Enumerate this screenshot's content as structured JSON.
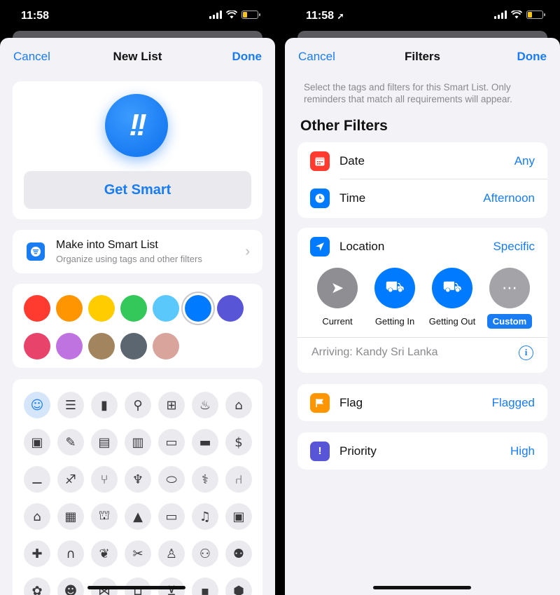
{
  "left": {
    "status_time": "11:58",
    "nav": {
      "cancel": "Cancel",
      "title": "New List",
      "done": "Done"
    },
    "list_icon_glyph": "!!",
    "list_name": "Get Smart",
    "smart_list": {
      "title": "Make into Smart List",
      "subtitle": "Organize using tags and other filters"
    },
    "colors": [
      "#ff3b30",
      "#ff9500",
      "#ffcc00",
      "#34c759",
      "#5ac8fa",
      "#007aff",
      "#5856d6",
      "#e8436b",
      "#bf73e0",
      "#a2845e",
      "#5b6670",
      "#d9a49b"
    ],
    "selected_color_index": 5,
    "icons": [
      {
        "name": "smiley-icon",
        "glyph": "☺"
      },
      {
        "name": "list-icon",
        "glyph": "☰"
      },
      {
        "name": "bookmark-icon",
        "glyph": "▮"
      },
      {
        "name": "pin-icon",
        "glyph": "⚲"
      },
      {
        "name": "gift-icon",
        "glyph": "⊞"
      },
      {
        "name": "birthday-cake-icon",
        "glyph": "♨"
      },
      {
        "name": "graduation-cap-icon",
        "glyph": "⌂"
      },
      {
        "name": "backpack-icon",
        "glyph": "▣"
      },
      {
        "name": "ruler-pencil-icon",
        "glyph": "✎"
      },
      {
        "name": "document-icon",
        "glyph": "▤"
      },
      {
        "name": "book-icon",
        "glyph": "▥"
      },
      {
        "name": "wallet-icon",
        "glyph": "▭"
      },
      {
        "name": "credit-card-icon",
        "glyph": "▬"
      },
      {
        "name": "money-icon",
        "glyph": "$"
      },
      {
        "name": "dumbbell-icon",
        "glyph": "⚊"
      },
      {
        "name": "running-icon",
        "glyph": "♐"
      },
      {
        "name": "fork-knife-icon",
        "glyph": "⑂"
      },
      {
        "name": "wine-glass-icon",
        "glyph": "♆"
      },
      {
        "name": "pills-icon",
        "glyph": "⬭"
      },
      {
        "name": "stethoscope-icon",
        "glyph": "⚕"
      },
      {
        "name": "chair-icon",
        "glyph": "⑁"
      },
      {
        "name": "house-icon",
        "glyph": "⌂"
      },
      {
        "name": "building-icon",
        "glyph": "▦"
      },
      {
        "name": "bank-icon",
        "glyph": "⛫"
      },
      {
        "name": "tent-icon",
        "glyph": "▲"
      },
      {
        "name": "desktop-icon",
        "glyph": "▭"
      },
      {
        "name": "music-note-icon",
        "glyph": "♫"
      },
      {
        "name": "computer-icon",
        "glyph": "▣"
      },
      {
        "name": "gamepad-icon",
        "glyph": "✚"
      },
      {
        "name": "headphones-icon",
        "glyph": "∩"
      },
      {
        "name": "leaf-icon",
        "glyph": "❦"
      },
      {
        "name": "carrot-icon",
        "glyph": "✂"
      },
      {
        "name": "person-icon",
        "glyph": "♙"
      },
      {
        "name": "two-people-icon",
        "glyph": "⚇"
      },
      {
        "name": "family-icon",
        "glyph": "⚉"
      },
      {
        "name": "paw-icon",
        "glyph": "✿"
      },
      {
        "name": "teddy-bear-icon",
        "glyph": "☻"
      },
      {
        "name": "fish-icon",
        "glyph": "⋈"
      },
      {
        "name": "basket-icon",
        "glyph": "⊔"
      },
      {
        "name": "cart-icon",
        "glyph": "⊻"
      },
      {
        "name": "bag-icon",
        "glyph": "▪"
      },
      {
        "name": "box-icon",
        "glyph": "⬢"
      }
    ]
  },
  "right": {
    "status_time": "11:58",
    "nav": {
      "cancel": "Cancel",
      "title": "Filters",
      "done": "Done"
    },
    "description": "Select the tags and filters for this Smart List. Only reminders that match all requirements will appear.",
    "section_title": "Other Filters",
    "date": {
      "label": "Date",
      "value": "Any",
      "color": "#ff3b30"
    },
    "time": {
      "label": "Time",
      "value": "Afternoon",
      "color": "#007aff"
    },
    "location": {
      "label": "Location",
      "value": "Specific",
      "color": "#007aff",
      "options": [
        {
          "label": "Current",
          "icon": "location-arrow-icon",
          "glyph": "➤",
          "bg": "#8e8e93"
        },
        {
          "label": "Getting In",
          "icon": "car-icon",
          "glyph": "⛟",
          "bg": "#007aff"
        },
        {
          "label": "Getting Out",
          "icon": "car-icon",
          "glyph": "⛟",
          "bg": "#007aff"
        },
        {
          "label": "Custom",
          "icon": "ellipsis-icon",
          "glyph": "⋯",
          "bg": "#a3a3a8"
        }
      ],
      "selected_option": 3,
      "arriving": "Arriving: Kandy Sri Lanka"
    },
    "flag": {
      "label": "Flag",
      "value": "Flagged",
      "color": "#ff9500"
    },
    "priority": {
      "label": "Priority",
      "value": "High",
      "color": "#5856d6",
      "glyph": "!"
    }
  }
}
